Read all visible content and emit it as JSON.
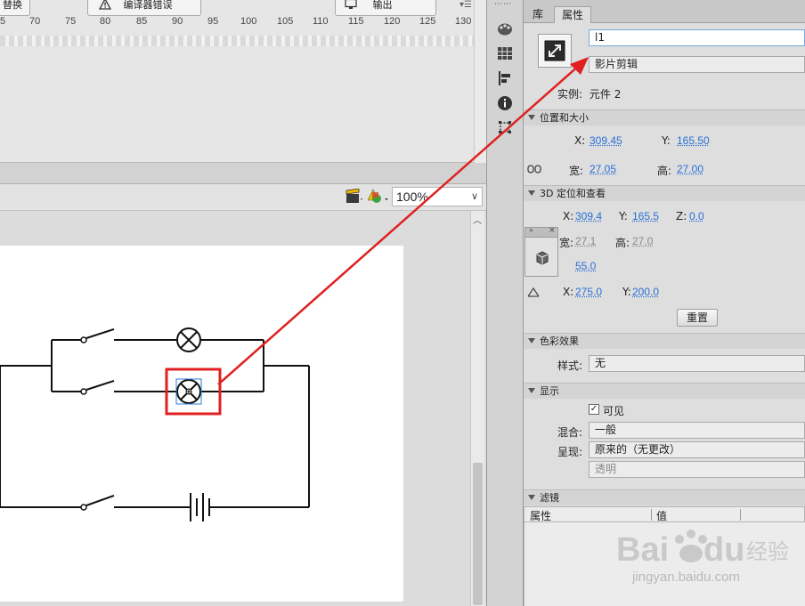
{
  "top_panel": {
    "tabs": [
      {
        "label": "替换",
        "icon": "replace-icon"
      },
      {
        "label": "编译器错误",
        "icon": "warning-icon"
      },
      {
        "label": "输出",
        "icon": "monitor-icon"
      }
    ],
    "ruler_labels": [
      "5",
      "70",
      "75",
      "80",
      "85",
      "90",
      "95",
      "100",
      "105",
      "110",
      "115",
      "120",
      "125",
      "130"
    ]
  },
  "stage": {
    "zoom_value": "100%",
    "edit_symbols_icon": "clapper-icon",
    "edit_scene_icon": "shapes-icon"
  },
  "toolbar_icons": [
    "palette-icon",
    "grid-icon",
    "align-icon",
    "info-icon",
    "transform-icon"
  ],
  "properties": {
    "tabs": {
      "library": "库",
      "properties": "属性"
    },
    "instance_name_value": "l1",
    "symbol_type": "影片剪辑",
    "instance_label": "实例:",
    "instance_value": "元件 2",
    "position_section": "位置和大小",
    "x_label": "X:",
    "x_value": "309.45",
    "y_label": "Y:",
    "y_value": "165.50",
    "width_label": "宽:",
    "width_value": "27.05",
    "height_label": "高:",
    "height_value": "27.00",
    "td_section": "3D 定位和查看",
    "td_x_label": "X:",
    "td_x_value": "309.4",
    "td_y_label": "Y:",
    "td_y_value": "165.5",
    "td_z_label": "Z:",
    "td_z_value": "0.0",
    "td_w_label": "宽:",
    "td_w_value": "27.1",
    "td_h_label": "高:",
    "td_h_value": "27.0",
    "perspective_value": "55.0",
    "vp_x_label": "X:",
    "vp_x_value": "275.0",
    "vp_y_label": "Y:",
    "vp_y_value": "200.0",
    "reset_button": "重置",
    "color_section": "色彩效果",
    "style_label": "样式:",
    "style_value": "无",
    "display_section": "显示",
    "visible_label": "可见",
    "blend_label": "混合:",
    "blend_value": "一般",
    "render_label": "呈现:",
    "render_value": "原来的（无更改）",
    "transparent_label": "透明",
    "filters_section": "滤镜",
    "filters_col_property": "属性",
    "filters_col_value": "值"
  },
  "watermark": {
    "brand": "Bai du 经验",
    "url": "jingyan.baidu.com"
  },
  "colors": {
    "highlight_red": "#e02020",
    "value_blue": "#2a6fd6"
  }
}
